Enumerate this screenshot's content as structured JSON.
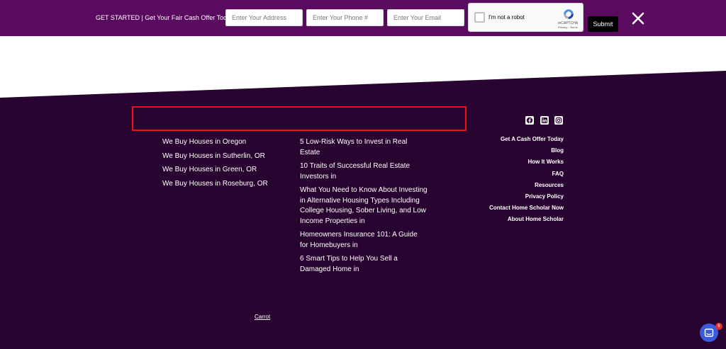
{
  "topbar": {
    "title": "GET STARTED | Get Your Fair Cash Offer Today",
    "address_placeholder": "Enter Your Address",
    "phone_placeholder": "Enter Your Phone #",
    "email_placeholder": "Enter Your Email",
    "submit_label": "Submit",
    "recaptcha": {
      "label": "I'm not a robot",
      "brand": "reCAPTCHA",
      "terms": "Privacy - Terms"
    },
    "bg_color": "#5a0a5f"
  },
  "footer": {
    "bg_color": "#2a0430",
    "locations": [
      "We Buy Houses in Oregon",
      "We Buy Houses in Sutherlin, OR",
      "We Buy Houses in Green, OR",
      "We Buy Houses in Roseburg, OR"
    ],
    "posts": [
      "5 Low-Risk Ways to Invest in Real Estate",
      "10 Traits of Successful Real Estate Investors in",
      "What You Need to Know About Investing in Alternative Housing Types Including College Housing, Sober Living, and Low Income Properties in",
      "Homeowners Insurance 101: A Guide for Homebuyers in",
      "6 Smart Tips to Help You Sell a Damaged Home in"
    ],
    "nav": [
      "Get A Cash Offer Today",
      "Blog",
      "How It Works",
      "FAQ",
      "Resources",
      "Privacy Policy",
      "Contact Home Scholar Now",
      "About Home Scholar"
    ],
    "social": [
      "facebook-icon",
      "linkedin-icon",
      "instagram-icon"
    ],
    "credit": "Carrot"
  },
  "chat": {
    "badge": "6",
    "color": "#3b5bdb"
  }
}
